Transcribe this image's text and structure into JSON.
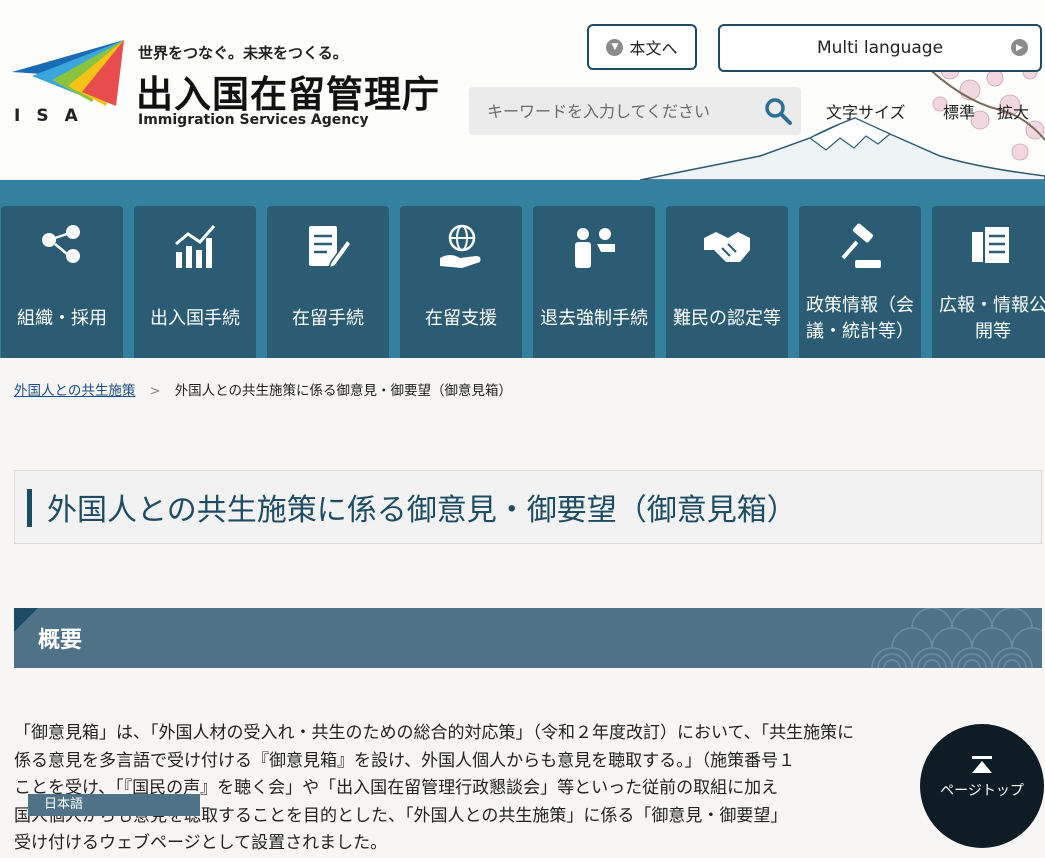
{
  "header": {
    "tagline": "世界をつなぐ。未来をつくる。",
    "agency_name": "出入国在留管理庁",
    "agency_english": "Immigration Services Agency",
    "logo_abbr": "ISA",
    "skip_label": "本文へ",
    "multi_language_label": "Multi language",
    "search": {
      "placeholder": "キーワードを入力してください"
    },
    "font_size_label": "文字サイズ",
    "font_standard": "標準",
    "font_large": "拡大"
  },
  "nav": {
    "items": [
      {
        "label": "組織・採用",
        "icon": "org-people-icon"
      },
      {
        "label": "出入国手続",
        "icon": "bar-chart-icon"
      },
      {
        "label": "在留手続",
        "icon": "document-pen-icon"
      },
      {
        "label": "在留支援",
        "icon": "globe-hand-icon"
      },
      {
        "label": "退去強制手続",
        "icon": "officer-person-icon"
      },
      {
        "label": "難民の認定等",
        "icon": "handshake-icon"
      },
      {
        "label": "政策情報（会議・統計等）",
        "icon": "gavel-icon"
      },
      {
        "label": "広報・情報公開等",
        "icon": "documents-icon"
      }
    ]
  },
  "breadcrumb": {
    "parent": "外国人との共生施策",
    "current": "外国人との共生施策に係る御意見・御要望（御意見箱）"
  },
  "page": {
    "title": "外国人との共生施策に係る御意見・御要望（御意見箱）",
    "section_heading": "概要",
    "body_lines": [
      "「御意見箱」は、「外国人材の受入れ・共生のための総合的対応策」（令和２年度改訂）において、「共生施策に",
      "係る意見を多言語で受け付ける『御意見箱』を設け、外国人個人からも意見を聴取する。」（施策番号１",
      "ことを受け、「『国民の声』を聴く会」や「出入国在留管理行政懇談会」等といった従前の取組に加え",
      "国人個人からも意見を聴取することを目的とした、「外国人との共生施策」に係る「御意見・御要望」",
      "受け付けるウェブページとして設置されました。"
    ]
  },
  "overlays": {
    "language_popup": "日本語",
    "page_top_label": "ページトップ"
  },
  "colors": {
    "nav_bar": "#33819e",
    "nav_tile": "#2b5c73",
    "accent_dark": "#1d4d64",
    "section_bg": "#4f7287"
  }
}
